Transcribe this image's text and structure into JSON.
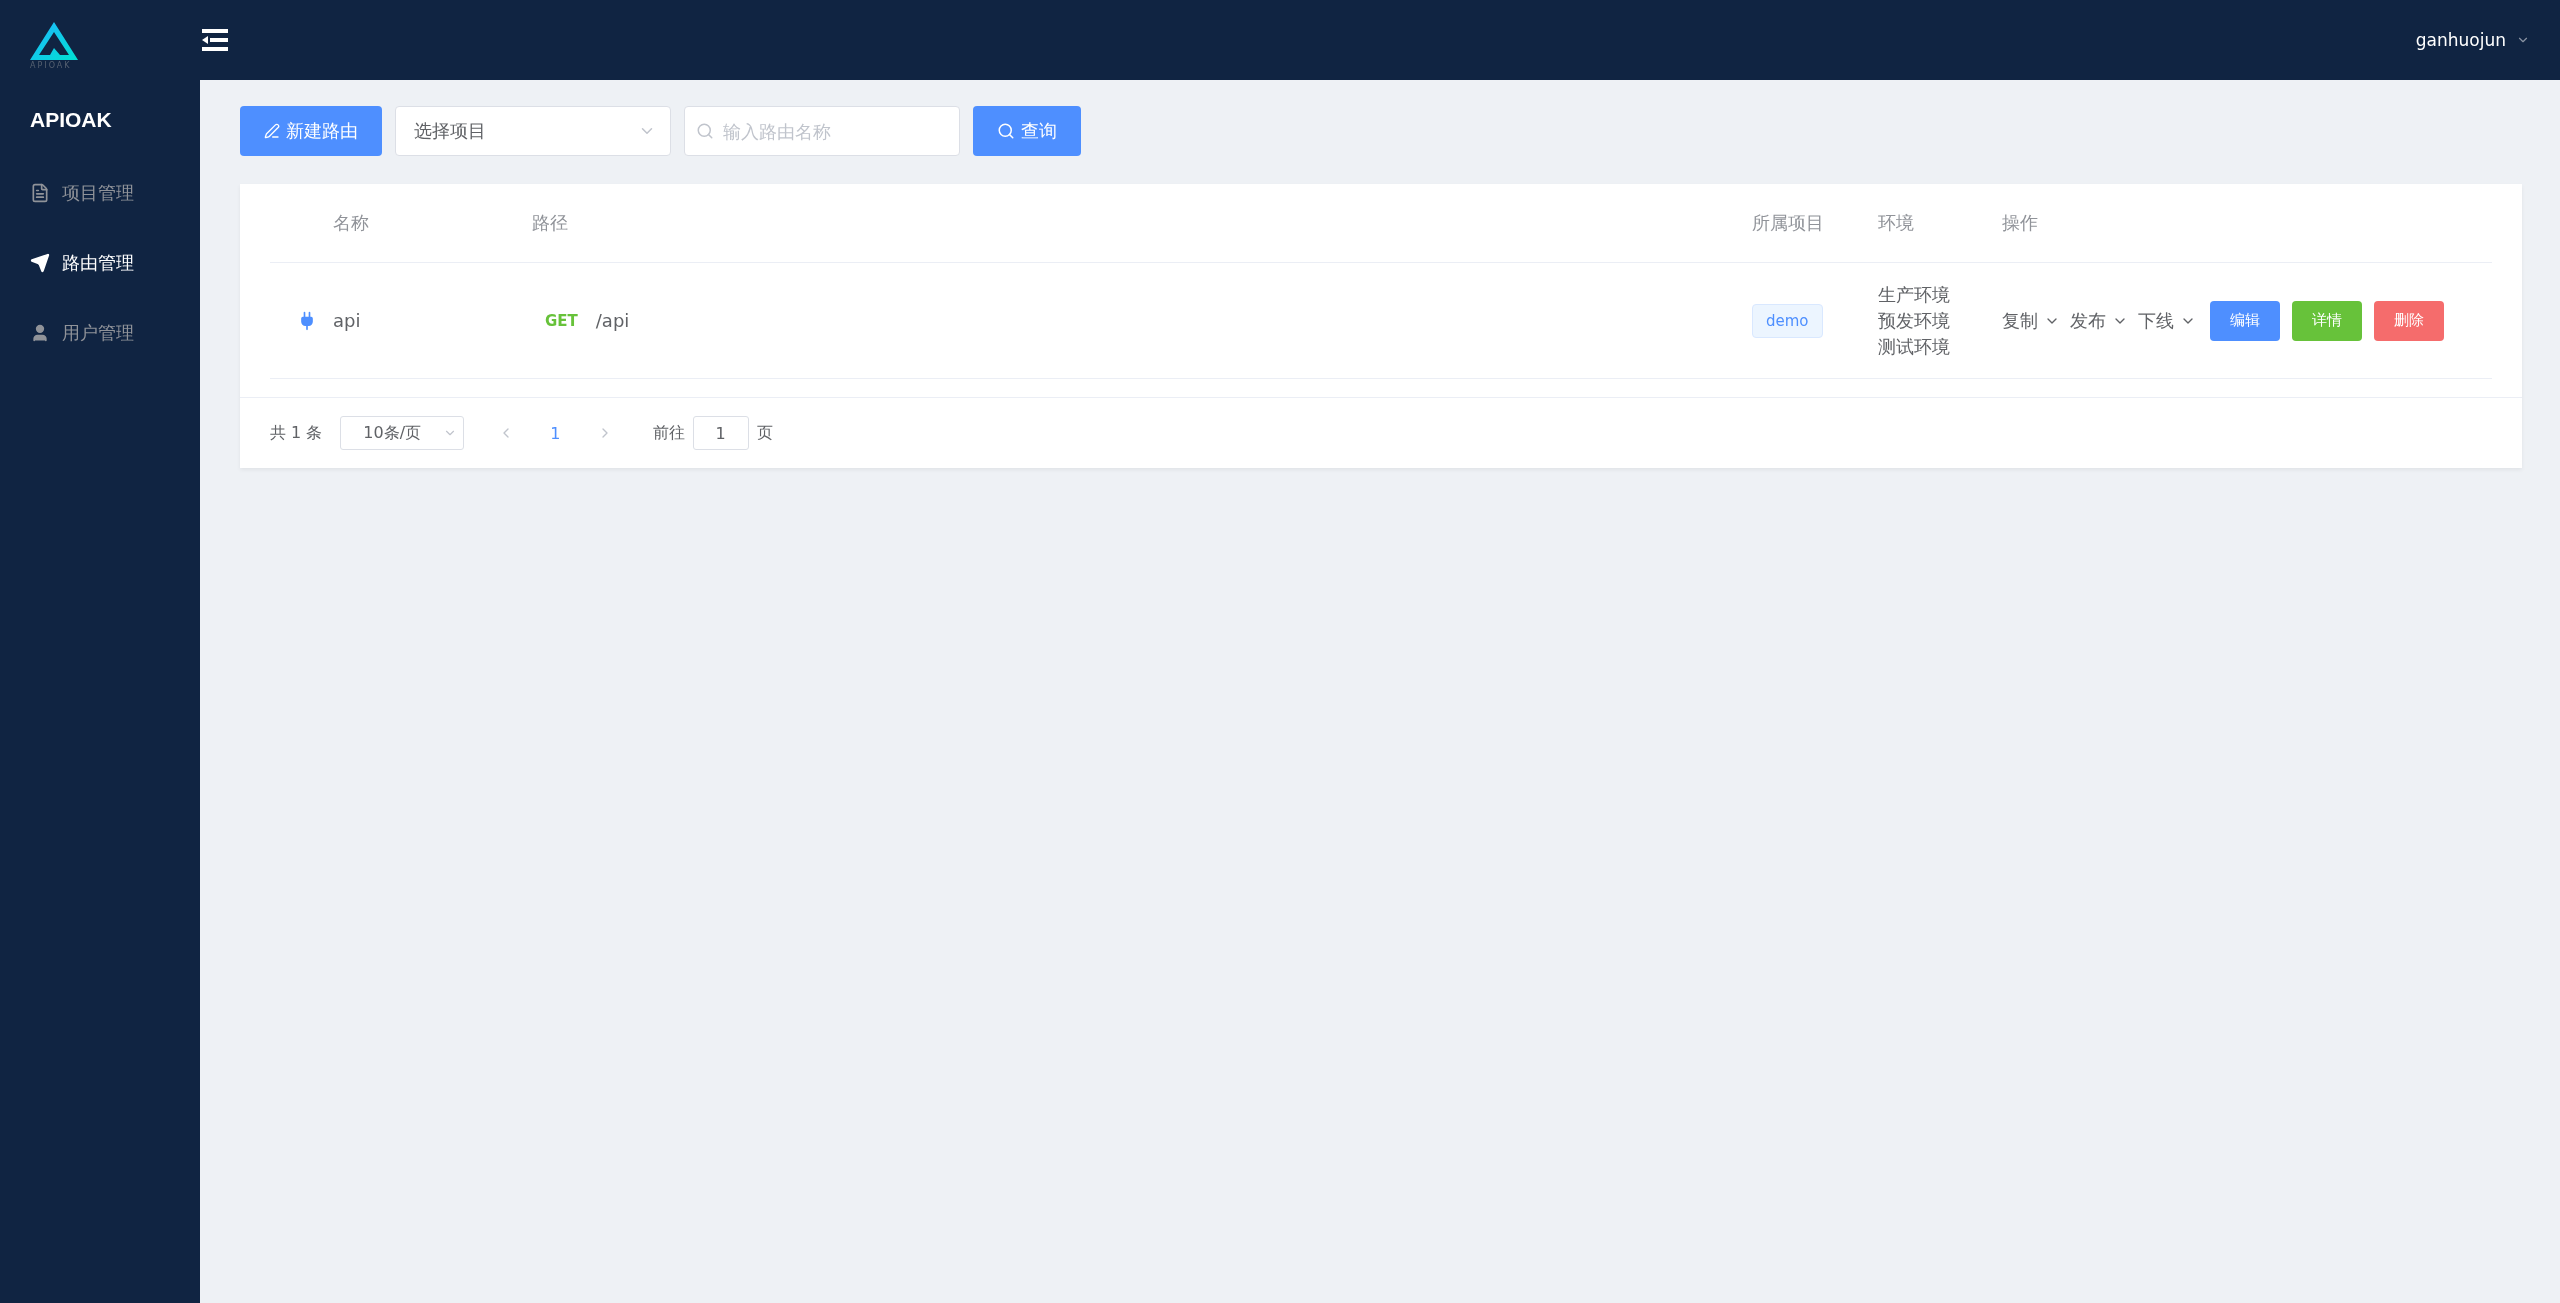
{
  "sidebar": {
    "logo_text": "APIOAK",
    "title": "APIOAK",
    "items": [
      {
        "label": "项目管理",
        "selected": false
      },
      {
        "label": "路由管理",
        "selected": true
      },
      {
        "label": "用户管理",
        "selected": false
      }
    ]
  },
  "header": {
    "user": "ganhuojun"
  },
  "toolbar": {
    "new_button": "新建路由",
    "project_select": {
      "value": "选择项目"
    },
    "search": {
      "placeholder": "输入路由名称"
    },
    "query_button": "查询"
  },
  "table": {
    "columns": [
      "名称",
      "路径",
      "所属项目",
      "环境",
      "操作"
    ],
    "rows": [
      {
        "name": "api",
        "method": "GET",
        "path": "/api",
        "project": "demo",
        "envs": [
          "生产环境",
          "预发环境",
          "测试环境"
        ],
        "dropdowns": [
          "复制",
          "发布",
          "下线"
        ],
        "buttons": [
          {
            "label": "编辑",
            "kind": "primary"
          },
          {
            "label": "详情",
            "kind": "success"
          },
          {
            "label": "删除",
            "kind": "danger"
          }
        ]
      }
    ]
  },
  "pagination": {
    "total": "共 1 条",
    "page_size": "10条/页",
    "pages": [
      {
        "label": "1",
        "selected": true
      }
    ],
    "goto_label": "前往",
    "goto_value": "1",
    "goto_suffix": "页"
  }
}
